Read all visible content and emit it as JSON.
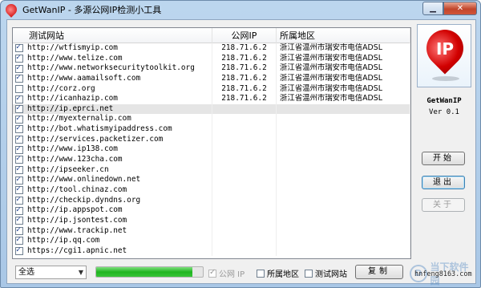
{
  "window": {
    "title": "GetWanIP - 多源公网IP检测小工具"
  },
  "table": {
    "headers": {
      "site": "测试网站",
      "ip": "公网IP",
      "location": "所属地区"
    },
    "rows": [
      {
        "checked": true,
        "site": "http://wtfismyip.com",
        "ip": "218.71.6.2",
        "location": "浙江省温州市瑞安市电信ADSL"
      },
      {
        "checked": true,
        "site": "http://www.telize.com",
        "ip": "218.71.6.2",
        "location": "浙江省温州市瑞安市电信ADSL"
      },
      {
        "checked": true,
        "site": "http://www.networksecuritytoolkit.org",
        "ip": "218.71.6.2",
        "location": "浙江省温州市瑞安市电信ADSL"
      },
      {
        "checked": true,
        "site": "http://www.aamailsoft.com",
        "ip": "218.71.6.2",
        "location": "浙江省温州市瑞安市电信ADSL"
      },
      {
        "checked": false,
        "site": "http://corz.org",
        "ip": "218.71.6.2",
        "location": "浙江省温州市瑞安市电信ADSL"
      },
      {
        "checked": true,
        "site": "http://icanhazip.com",
        "ip": "218.71.6.2",
        "location": "浙江省温州市瑞安市电信ADSL"
      },
      {
        "checked": true,
        "site": "http://ip.eprci.net",
        "ip": "",
        "location": ""
      },
      {
        "checked": true,
        "site": "http://myexternalip.com",
        "ip": "",
        "location": ""
      },
      {
        "checked": true,
        "site": "http://bot.whatismyipaddress.com",
        "ip": "",
        "location": ""
      },
      {
        "checked": true,
        "site": "http://services.packetizer.com",
        "ip": "",
        "location": ""
      },
      {
        "checked": true,
        "site": "http://www.ip138.com",
        "ip": "",
        "location": ""
      },
      {
        "checked": true,
        "site": "http://www.123cha.com",
        "ip": "",
        "location": ""
      },
      {
        "checked": true,
        "site": "http://ipseeker.cn",
        "ip": "",
        "location": ""
      },
      {
        "checked": true,
        "site": "http://www.onlinedown.net",
        "ip": "",
        "location": ""
      },
      {
        "checked": true,
        "site": "http://tool.chinaz.com",
        "ip": "",
        "location": ""
      },
      {
        "checked": true,
        "site": "http://checkip.dyndns.org",
        "ip": "",
        "location": ""
      },
      {
        "checked": true,
        "site": "http://ip.appspot.com",
        "ip": "",
        "location": ""
      },
      {
        "checked": true,
        "site": "http://ip.jsontest.com",
        "ip": "",
        "location": ""
      },
      {
        "checked": true,
        "site": "http://www.trackip.net",
        "ip": "",
        "location": ""
      },
      {
        "checked": true,
        "site": "http://ip.qq.com",
        "ip": "",
        "location": ""
      },
      {
        "checked": true,
        "site": "https://cgi1.apnic.net",
        "ip": "",
        "location": ""
      }
    ],
    "selected_row": 6
  },
  "side_panel": {
    "logo_text": "IP",
    "app_name": "GetWanIP",
    "version": "Ver 0.1",
    "start_label": "开始",
    "exit_label": "退出",
    "about_label": "关于"
  },
  "bottom": {
    "select_value": "全选",
    "progress_fraction": 0.9,
    "opt_ip_label": "公网 IP",
    "opt_ip_checked": true,
    "opt_loc_label": "所属地区",
    "opt_loc_checked": false,
    "opt_site_label": "测试网站",
    "opt_site_checked": false,
    "copy_label": "复制",
    "contact": "hnfeng8163.com"
  },
  "watermark": {
    "text": "当下软件园"
  },
  "icons": [
    "app-pin-icon",
    "minimize-icon",
    "close-icon",
    "checkbox-icon",
    "dropdown-arrow-icon"
  ]
}
